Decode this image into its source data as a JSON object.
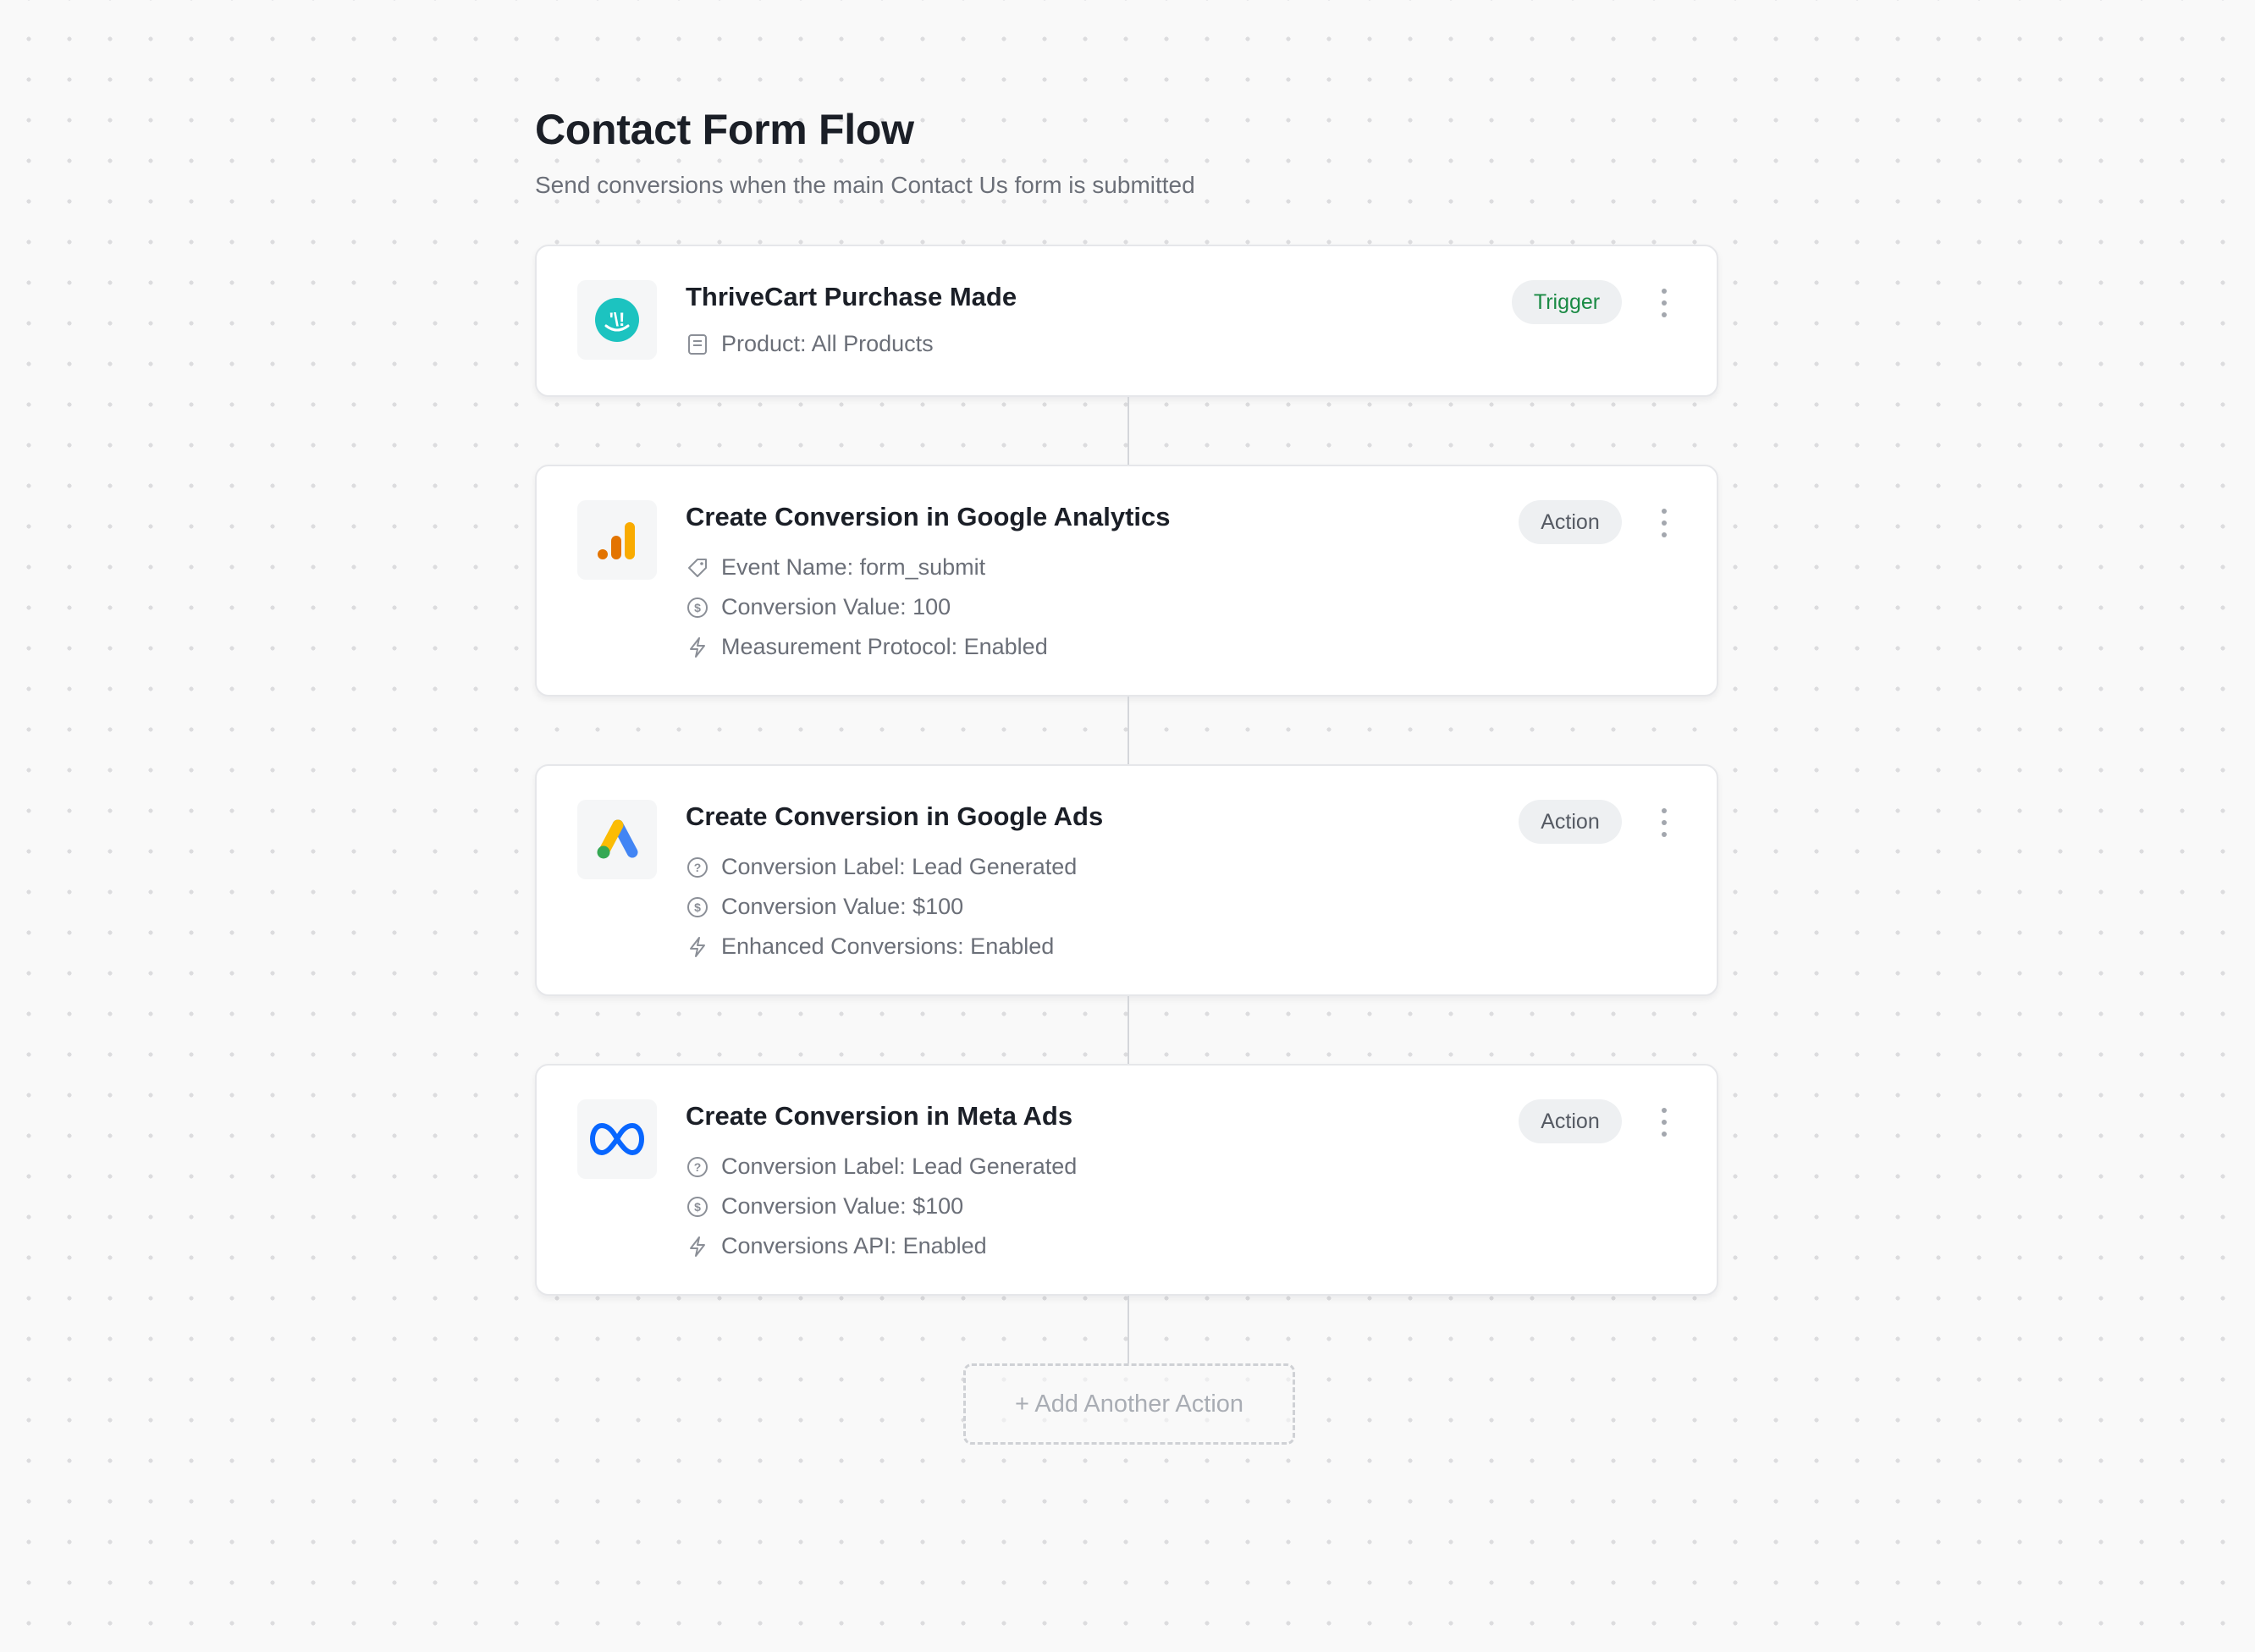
{
  "header": {
    "title": "Contact Form Flow",
    "subtitle": "Send conversions when the main Contact Us form is submitted"
  },
  "steps": [
    {
      "title": "ThriveCart Purchase Made",
      "badge": "Trigger",
      "icon": "thrivecart-logo-icon",
      "props": [
        {
          "icon": "document-icon",
          "text": "Product: All Products"
        }
      ]
    },
    {
      "title": "Create Conversion in Google Analytics",
      "badge": "Action",
      "icon": "google-analytics-logo-icon",
      "props": [
        {
          "icon": "tag-icon",
          "text": "Event Name: form_submit"
        },
        {
          "icon": "dollar-circle-icon",
          "text": "Conversion Value: 100"
        },
        {
          "icon": "lightning-icon",
          "text": "Measurement Protocol: Enabled"
        }
      ]
    },
    {
      "title": "Create Conversion in Google Ads",
      "badge": "Action",
      "icon": "google-ads-logo-icon",
      "props": [
        {
          "icon": "question-circle-icon",
          "text": "Conversion Label: Lead Generated"
        },
        {
          "icon": "dollar-circle-icon",
          "text": "Conversion Value: $100"
        },
        {
          "icon": "lightning-icon",
          "text": "Enhanced Conversions: Enabled"
        }
      ]
    },
    {
      "title": "Create Conversion in Meta Ads",
      "badge": "Action",
      "icon": "meta-logo-icon",
      "props": [
        {
          "icon": "question-circle-icon",
          "text": "Conversion Label: Lead Generated"
        },
        {
          "icon": "dollar-circle-icon",
          "text": "Conversion Value: $100"
        },
        {
          "icon": "lightning-icon",
          "text": "Conversions API: Enabled"
        }
      ]
    }
  ],
  "add_action_label": "+ Add Another Action",
  "colors": {
    "trigger_badge_text": "#1a8a44",
    "thrivecart_teal": "#1cc3c0",
    "analytics_orange": "#f9ab00",
    "analytics_dark_orange": "#e37400",
    "ads_blue": "#4285f4",
    "ads_yellow": "#fbbc04",
    "ads_green": "#34a853",
    "meta_blue": "#0866ff"
  }
}
